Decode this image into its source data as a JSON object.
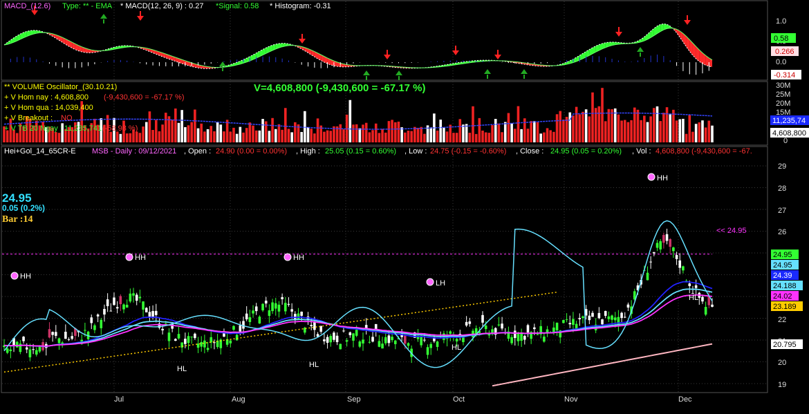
{
  "colors": {
    "background": "#000000",
    "grid": "#3a3a3a",
    "up": "#33ff33",
    "down": "#ff2a2a",
    "cyan": "#66e0ff",
    "blue": "#2222ff",
    "magenta": "#ff33ff",
    "yellow_dot": "#ffcc00",
    "pink": "#ffb6c1"
  },
  "macd_panel": {
    "legend_name": "MACD_(12.6)",
    "legend_type": "Type: ** - EMA",
    "legend_macd": "* MACD(12, 26, 9) : 0.27",
    "legend_signal": "*Signal: 0.58",
    "legend_hist": "* Histogram: -0.31",
    "axis_ticks": [
      "1.0",
      "0.5",
      "0.0",
      "-0.5"
    ],
    "badge_signal": "0.58",
    "badge_macd": "0.266",
    "badge_hist": "-0.314"
  },
  "volume_panel": {
    "title": "** VOLUME Oscillator_(30.10.21)",
    "v_line": "V=4,608,800 (-9,430,600 = -67.17 %)",
    "line1": "+ V Hom nay : 4,608,800",
    "line1_delta": "(-9,430,600 = -67.17 %)",
    "line2": "+ V Hom qua : 14,039,400",
    "line3_label": "+ V Breakout :",
    "line3_val": "NO",
    "line4": "+ V TB 20 Ngay : 11,235,741",
    "line4_delta": "(-58.98 %)",
    "axis_ticks": [
      "30M",
      "25M",
      "20M",
      "15M",
      "10M",
      "5M",
      "0"
    ],
    "badge_avg": "11,235,74",
    "badge_vol": "4,608,800"
  },
  "price_panel": {
    "header_name": "Hei+Gol_14_65CR-E",
    "header_symbol": "MSB - Daily : 09/12/2021",
    "open_label": ", Open :",
    "open_val": "24.90 (0.00 = 0.00%)",
    "high_label": ", High :",
    "high_val": "25.05 (0.15 = 0.60%)",
    "low_label": ", Low :",
    "low_val": "24.75 (-0.15 = -0.60%)",
    "close_label": ", Close :",
    "close_val": "24.95 (0.05 = 0.20%)",
    "vol_label": ", Vol :",
    "vol_val": "4,608,800 (-9,430,600 = -67.",
    "big_price": "24.95",
    "big_change": "0.05 (0.2%)",
    "bar_count": "Bar :14",
    "last_marker": "<< 24.95",
    "axis_ticks": [
      "29",
      "28",
      "27",
      "26",
      "25",
      "24",
      "23",
      "22",
      "21",
      "20",
      "19"
    ],
    "badges": [
      "24.95",
      "24.95",
      "24.39",
      "24.188",
      "24.02",
      "23.189",
      "20.795"
    ],
    "annotations": [
      "HH",
      "HH",
      "HH",
      "HH",
      "LH",
      "HL",
      "HL",
      "HL",
      "HL"
    ]
  },
  "x_axis": {
    "months": [
      "Jul",
      "Aug",
      "Sep",
      "Oct",
      "Nov",
      "Dec"
    ]
  },
  "chart_data": {
    "type": "candlestick",
    "symbol": "MSB",
    "timeframe": "Daily",
    "date": "09/12/2021",
    "last": {
      "open": 24.9,
      "high": 25.05,
      "low": 24.75,
      "close": 24.95,
      "volume": 4608800
    },
    "series": [
      {
        "name": "MACD",
        "last": 0.27
      },
      {
        "name": "Signal",
        "last": 0.58
      },
      {
        "name": "Histogram",
        "last": -0.31
      },
      {
        "name": "V TB 20 Ngay",
        "last": 11235741
      }
    ],
    "x_categories": [
      "Jul",
      "Aug",
      "Sep",
      "Oct",
      "Nov",
      "Dec"
    ],
    "price_ylim": [
      18.5,
      29.5
    ],
    "macd_ylim": [
      -0.55,
      1.2
    ],
    "volume_ylim": [
      0,
      30000000
    ]
  }
}
